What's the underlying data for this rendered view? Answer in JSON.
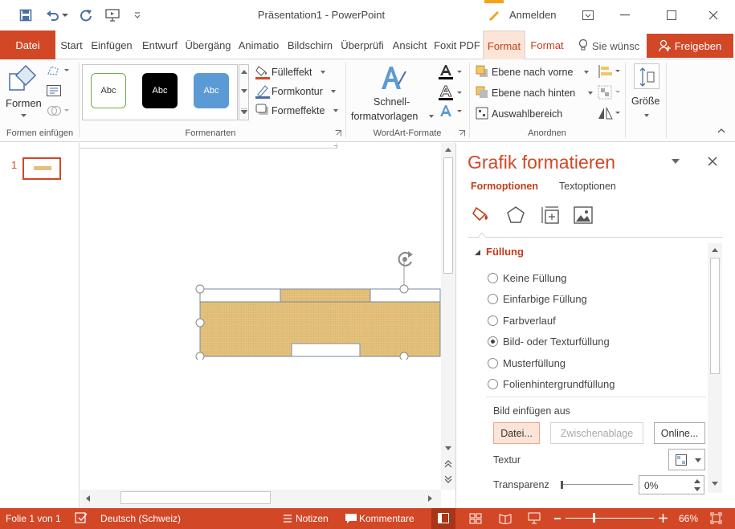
{
  "window": {
    "title": "Präsentation1 - PowerPoint",
    "sign_in": "Anmelden"
  },
  "tabs": [
    {
      "label": "Datei"
    },
    {
      "label": "Start"
    },
    {
      "label": "Einfügen"
    },
    {
      "label": "Entwurf"
    },
    {
      "label": "Übergäng"
    },
    {
      "label": "Animatio"
    },
    {
      "label": "Bildschirn"
    },
    {
      "label": "Überprüfi"
    },
    {
      "label": "Ansicht"
    },
    {
      "label": "Foxit PDF"
    },
    {
      "label": "Format"
    },
    {
      "label": "Format"
    }
  ],
  "tell_me": "Sie wünsc",
  "share": "Freigeben",
  "ribbon": {
    "shapes_label": "Formen",
    "group_insert_shapes": "Formen einfügen",
    "style_samples": [
      "Abc",
      "Abc",
      "Abc"
    ],
    "fill": "Fülleffekt",
    "outline": "Formkontur",
    "effects": "Formeffekte",
    "group_styles": "Formenarten",
    "quick_styles_line1": "Schnell-",
    "quick_styles_line2": "formatvorlagen",
    "group_wordart": "WordArt-Formate",
    "bring_forward": "Ebene nach vorne",
    "send_backward": "Ebene nach hinten",
    "selection_pane": "Auswahlbereich",
    "group_arrange": "Anordnen",
    "size": "Größe"
  },
  "slides_pane": {
    "slide_number": "1"
  },
  "format_pane": {
    "title": "Grafik formatieren",
    "tab_shape": "Formoptionen",
    "tab_text": "Textoptionen",
    "section_fill": "Füllung",
    "options": [
      {
        "label": "Keine Füllung",
        "selected": false
      },
      {
        "label": "Einfarbige Füllung",
        "selected": false
      },
      {
        "label": "Farbverlauf",
        "selected": false
      },
      {
        "label": "Bild- oder Texturfüllung",
        "selected": true
      },
      {
        "label": "Musterfüllung",
        "selected": false
      },
      {
        "label": "Folienhintergrundfüllung",
        "selected": false
      }
    ],
    "insert_picture_from": "Bild einfügen aus",
    "btn_file": "Datei...",
    "btn_clipboard": "Zwischenablage",
    "btn_online": "Online...",
    "texture_label": "Textur",
    "transparency_label": "Transparenz",
    "transparency_value": "0%",
    "transparency_level": 0
  },
  "status": {
    "slide_info": "Folie 1 von 1",
    "language": "Deutsch (Schweiz)",
    "notes": "Notizen",
    "comments": "Kommentare",
    "zoom": "66%",
    "zoom_level": 0.66
  },
  "colors": {
    "accent": "#d24726",
    "ribbon_bg": "#fcfcfc",
    "texture": "#e3c07a",
    "context_tab": "#f3a21c"
  }
}
